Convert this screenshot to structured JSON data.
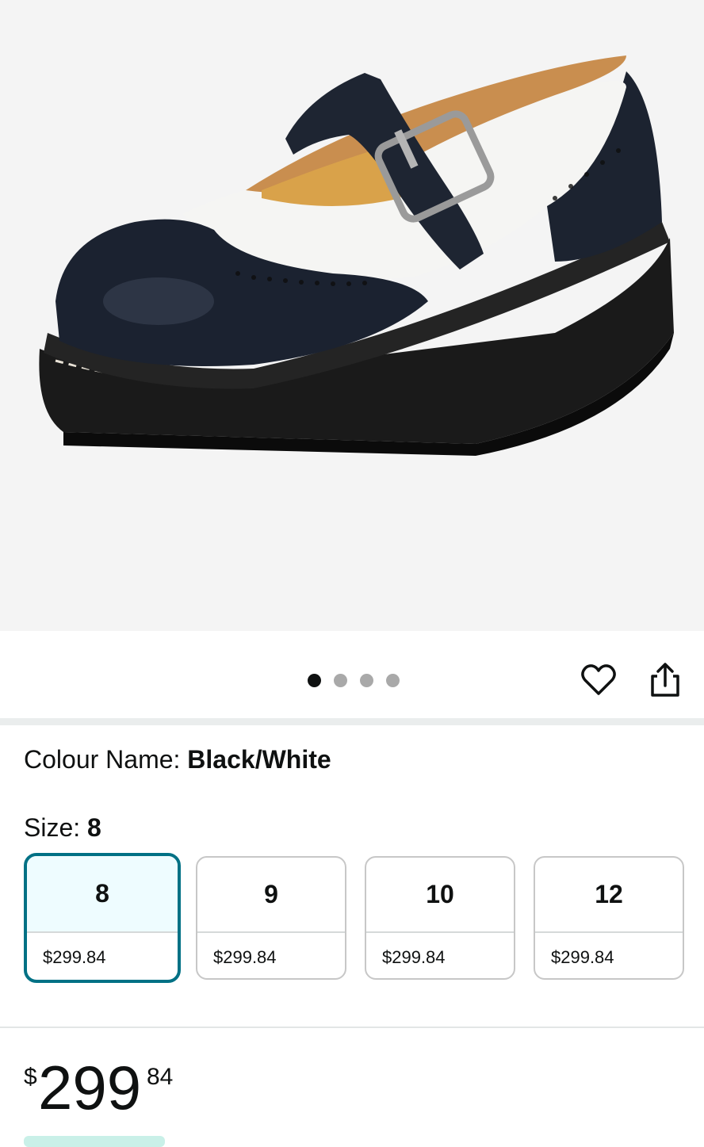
{
  "product": {
    "image_alt": "Black and white brogue Mary Jane shoe with buckle strap",
    "carousel": {
      "total": 4,
      "active": 0
    },
    "colour_label": "Colour Name: ",
    "colour_value": "Black/White",
    "size_label": "Size: ",
    "size_value": "8",
    "sizes": [
      {
        "size": "8",
        "price": "$299.84",
        "selected": true
      },
      {
        "size": "9",
        "price": "$299.84",
        "selected": false
      },
      {
        "size": "10",
        "price": "$299.84",
        "selected": false
      },
      {
        "size": "12",
        "price": "$299.84",
        "selected": false
      }
    ],
    "price": {
      "symbol": "$",
      "whole": "299",
      "fraction": "84"
    }
  },
  "icons": {
    "wishlist": "heart-icon",
    "share": "share-icon"
  },
  "colors": {
    "accent": "#007185",
    "selected_bg": "#eefcff",
    "text": "#0f1111"
  }
}
